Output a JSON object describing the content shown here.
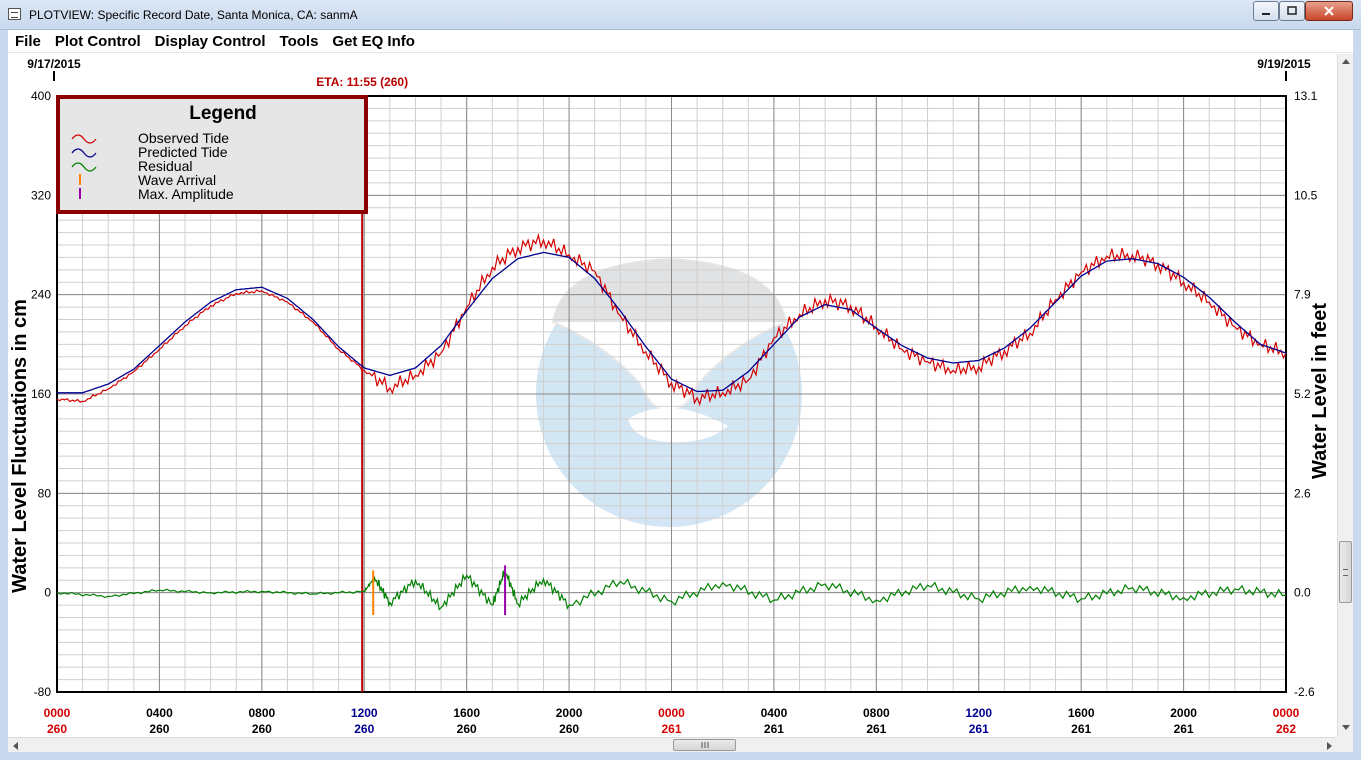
{
  "window": {
    "title": "PLOTVIEW: Specific Record Date, Santa Monica, CA: sanmA"
  },
  "menu": [
    "File",
    "Plot Control",
    "Display Control",
    "Tools",
    "Get EQ Info"
  ],
  "colors": {
    "observed": "#d40000",
    "predicted": "#000090",
    "residual": "#008000",
    "wave_arrival": "#ff8000",
    "max_amplitude": "#9900aa",
    "eta_line": "#b80000",
    "legend_border": "#8b0000"
  },
  "icons": {
    "app": "app-window-icon",
    "minimize": "minimize-icon",
    "maximize": "maximize-icon",
    "close": "close-icon",
    "scroll_grip": "scroll-grip-icon",
    "scroll_up": "scroll-up-arrow-icon",
    "scroll_down": "scroll-down-arrow-icon",
    "scroll_left": "scroll-left-arrow-icon",
    "scroll_right": "scroll-right-arrow-icon",
    "watermark": "noaa-logo-watermark"
  },
  "chart_data": {
    "type": "line",
    "start_date_label": "9/17/2015",
    "end_date_label": "9/19/2015",
    "eta_label": "ETA: 11:55 (260)",
    "eta_hours": 11.92,
    "ylabel": "Water Level Fluctuations in cm",
    "ylabel_right": "Water Level in feet",
    "ylim": [
      -80,
      400
    ],
    "ylim_right": [
      -2.6,
      13.1
    ],
    "y_ticks": [
      "400",
      "320",
      "240",
      "160",
      "80",
      "0",
      "-80"
    ],
    "y_ticks_right": [
      "13.1",
      "10.5",
      "7.9",
      "5.2",
      "2.6",
      "0.0",
      "-2.6"
    ],
    "xlim_hours": [
      0,
      48
    ],
    "x_ticks": [
      {
        "time": "0000",
        "day": "260",
        "color": "#d40000"
      },
      {
        "time": "0400",
        "day": "260",
        "color": "#000000"
      },
      {
        "time": "0800",
        "day": "260",
        "color": "#000000"
      },
      {
        "time": "1200",
        "day": "260",
        "color": "#000090"
      },
      {
        "time": "1600",
        "day": "260",
        "color": "#000000"
      },
      {
        "time": "2000",
        "day": "260",
        "color": "#000000"
      },
      {
        "time": "0000",
        "day": "261",
        "color": "#d40000"
      },
      {
        "time": "0400",
        "day": "261",
        "color": "#000000"
      },
      {
        "time": "0800",
        "day": "261",
        "color": "#000000"
      },
      {
        "time": "1200",
        "day": "261",
        "color": "#000090"
      },
      {
        "time": "1600",
        "day": "261",
        "color": "#000000"
      },
      {
        "time": "2000",
        "day": "261",
        "color": "#000000"
      },
      {
        "time": "0000",
        "day": "262",
        "color": "#d40000"
      }
    ],
    "legend": {
      "title": "Legend",
      "entries": [
        "Observed Tide",
        "Predicted Tide",
        "Residual",
        "Wave Arrival",
        "Max. Amplitude"
      ]
    },
    "grid": true,
    "series": [
      {
        "name": "Predicted Tide",
        "x": [
          0,
          1,
          2,
          3,
          4,
          5,
          6,
          7,
          8,
          9,
          10,
          11,
          12,
          13,
          14,
          15,
          16,
          17,
          18,
          19,
          20,
          21,
          22,
          23,
          24,
          25,
          26,
          27,
          28,
          29,
          30,
          31,
          32,
          33,
          34,
          35,
          36,
          37,
          38,
          39,
          40,
          41,
          42,
          43,
          44,
          45,
          46,
          47,
          48
        ],
        "values": [
          161,
          161,
          168,
          180,
          199,
          218,
          234,
          244,
          246,
          237,
          220,
          198,
          181,
          175,
          181,
          199,
          227,
          253,
          269,
          274,
          270,
          253,
          227,
          198,
          172,
          162,
          163,
          178,
          200,
          222,
          232,
          228,
          213,
          199,
          189,
          185,
          187,
          197,
          213,
          234,
          255,
          267,
          269,
          265,
          254,
          238,
          218,
          200,
          193
        ]
      },
      {
        "name": "Observed Tide",
        "x": [
          0,
          1,
          2,
          3,
          4,
          5,
          6,
          7,
          8,
          9,
          10,
          11,
          12,
          13,
          14,
          15,
          16,
          17,
          18,
          19,
          20,
          21,
          22,
          23,
          24,
          25,
          26,
          27,
          28,
          29,
          30,
          31,
          32,
          33,
          34,
          35,
          36,
          37,
          38,
          39,
          40,
          41,
          42,
          43,
          44,
          45,
          46,
          47,
          48
        ],
        "values": [
          156,
          154,
          164,
          178,
          196,
          215,
          231,
          241,
          243,
          234,
          218,
          196,
          179,
          165,
          175,
          193,
          230,
          262,
          278,
          284,
          272,
          259,
          223,
          194,
          169,
          157,
          161,
          171,
          205,
          224,
          236,
          231,
          214,
          196,
          186,
          179,
          182,
          195,
          209,
          236,
          258,
          271,
          272,
          265,
          250,
          234,
          214,
          200,
          193
        ]
      },
      {
        "name": "Residual",
        "x": [
          0,
          2,
          4,
          6,
          8,
          10,
          12,
          12.4,
          13,
          14,
          15,
          16,
          17,
          17.5,
          18,
          19,
          20,
          22,
          24,
          26,
          28,
          30,
          32,
          34,
          36,
          38,
          40,
          42,
          44,
          46,
          48
        ],
        "values": [
          0,
          -3,
          2,
          0,
          1,
          -1,
          1,
          12,
          -8,
          10,
          -12,
          14,
          -10,
          18,
          -9,
          11,
          -10,
          9,
          -7,
          8,
          -6,
          7,
          -6,
          6,
          -5,
          5,
          -5,
          4,
          -4,
          3,
          -2
        ]
      }
    ],
    "wave_arrival_hours": 12.35,
    "max_amplitude_hours": 17.5
  }
}
